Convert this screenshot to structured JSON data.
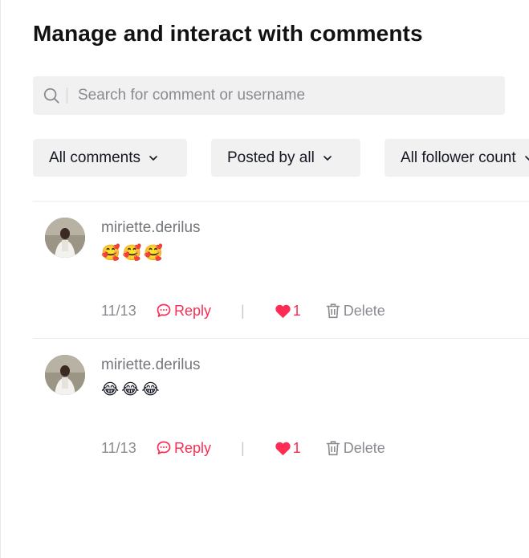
{
  "page": {
    "title": "Manage and interact with comments"
  },
  "search": {
    "placeholder": "Search for comment or username",
    "value": ""
  },
  "filters": [
    {
      "label": "All comments"
    },
    {
      "label": "Posted by all"
    },
    {
      "label": "All follower count"
    }
  ],
  "comments": [
    {
      "username": "miriette.derilus",
      "text": "🥰🥰🥰",
      "date": "11/13",
      "reply_label": "Reply",
      "likes": "1",
      "delete_label": "Delete"
    },
    {
      "username": "miriette.derilus",
      "text": "😂😂😂",
      "date": "11/13",
      "reply_label": "Reply",
      "likes": "1",
      "delete_label": "Delete"
    }
  ],
  "colors": {
    "accent": "#fe2c55",
    "muted_text": "#8a8b91",
    "surface": "#f1f1f2"
  }
}
